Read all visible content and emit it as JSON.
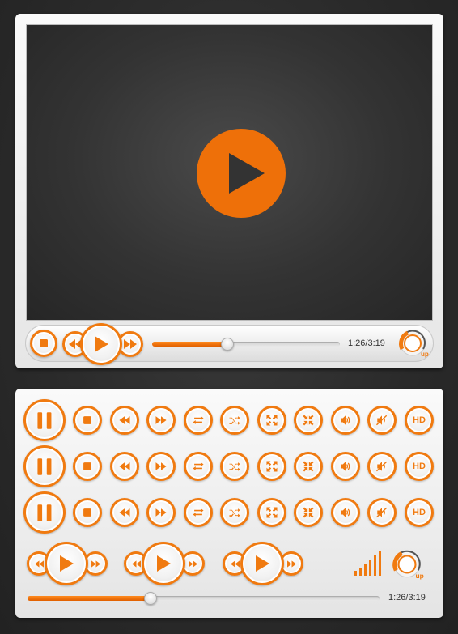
{
  "colors": {
    "accent": "#f07a10",
    "screen": "#333333",
    "panel": "#f2f2f2"
  },
  "player": {
    "big_play_icon": "play-icon",
    "controls": {
      "stop_icon": "stop-icon",
      "rewind_icon": "rewind-icon",
      "play_icon": "play-icon",
      "forward_icon": "fast-forward-icon",
      "progress": 0.4,
      "time": "1:26/3:19",
      "volume_knob_label": "up"
    }
  },
  "button_grid": {
    "rows": 3,
    "icons": [
      "pause-icon",
      "stop-icon",
      "rewind-icon",
      "fast-forward-icon",
      "repeat-icon",
      "shuffle-icon",
      "fullscreen-icon",
      "exit-fullscreen-icon",
      "volume-icon",
      "mute-icon",
      "hd-icon"
    ],
    "hd_label": "HD"
  },
  "bottom_controls": {
    "play_groups": 3,
    "volume_bars": 6,
    "volume_knob_label": "up",
    "progress": 0.35,
    "time": "1:26/3:19"
  }
}
